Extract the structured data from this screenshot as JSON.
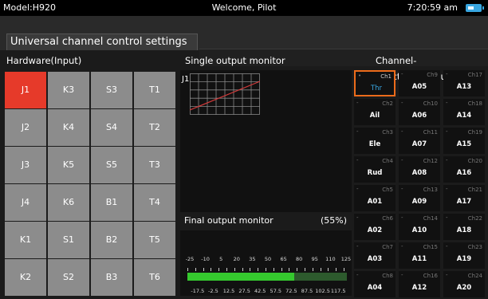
{
  "statusbar": {
    "model": "Model:H920",
    "welcome": "Welcome, Pilot",
    "clock": "7:20:59 am"
  },
  "tab": {
    "title": "Universal channel control settings"
  },
  "sections": {
    "hardware": "Hardware(Input)",
    "single_monitor": "Single output monitor",
    "channel_function": "Channel-Function(Output)"
  },
  "hardware_grid": [
    [
      "J1",
      "K3",
      "S3",
      "T1"
    ],
    [
      "J2",
      "K4",
      "S4",
      "T2"
    ],
    [
      "J3",
      "K5",
      "S5",
      "T3"
    ],
    [
      "J4",
      "K6",
      "B1",
      "T4"
    ],
    [
      "K1",
      "S1",
      "B2",
      "T5"
    ],
    [
      "K2",
      "S2",
      "B3",
      "T6"
    ]
  ],
  "hardware_active": "J1",
  "monitor": {
    "label": "J1"
  },
  "final_monitor": {
    "label": "Final output monitor",
    "percent_text": "(55%)",
    "percent": 55,
    "scale_top": [
      "-25",
      "-10",
      "5",
      "20",
      "35",
      "50",
      "65",
      "80",
      "95",
      "110",
      "125"
    ],
    "scale_bottom": [
      "-17.5",
      "-2.5",
      "12.5",
      "27.5",
      "42.5",
      "57.5",
      "72.5",
      "87.5",
      "102.5",
      "117.5"
    ]
  },
  "channels": [
    [
      {
        "ch": "Ch1",
        "fn": "Thr",
        "selected": true
      },
      {
        "ch": "Ch9",
        "fn": "A05"
      },
      {
        "ch": "Ch17",
        "fn": "A13"
      }
    ],
    [
      {
        "ch": "Ch2",
        "fn": "Ail"
      },
      {
        "ch": "Ch10",
        "fn": "A06"
      },
      {
        "ch": "Ch18",
        "fn": "A14"
      }
    ],
    [
      {
        "ch": "Ch3",
        "fn": "Ele"
      },
      {
        "ch": "Ch11",
        "fn": "A07"
      },
      {
        "ch": "Ch19",
        "fn": "A15"
      }
    ],
    [
      {
        "ch": "Ch4",
        "fn": "Rud"
      },
      {
        "ch": "Ch12",
        "fn": "A08"
      },
      {
        "ch": "Ch20",
        "fn": "A16"
      }
    ],
    [
      {
        "ch": "Ch5",
        "fn": "A01"
      },
      {
        "ch": "Ch13",
        "fn": "A09"
      },
      {
        "ch": "Ch21",
        "fn": "A17"
      }
    ],
    [
      {
        "ch": "Ch6",
        "fn": "A02"
      },
      {
        "ch": "Ch14",
        "fn": "A10"
      },
      {
        "ch": "Ch22",
        "fn": "A18"
      }
    ],
    [
      {
        "ch": "Ch7",
        "fn": "A03"
      },
      {
        "ch": "Ch15",
        "fn": "A11"
      },
      {
        "ch": "Ch23",
        "fn": "A19"
      }
    ],
    [
      {
        "ch": "Ch8",
        "fn": "A04"
      },
      {
        "ch": "Ch16",
        "fn": "A12"
      },
      {
        "ch": "Ch24",
        "fn": "A20"
      }
    ]
  ],
  "colors": {
    "active": "#e63a2a",
    "selected_border": "#ec6b1b",
    "accent": "#38a6e0",
    "bar": "#35c92e"
  }
}
